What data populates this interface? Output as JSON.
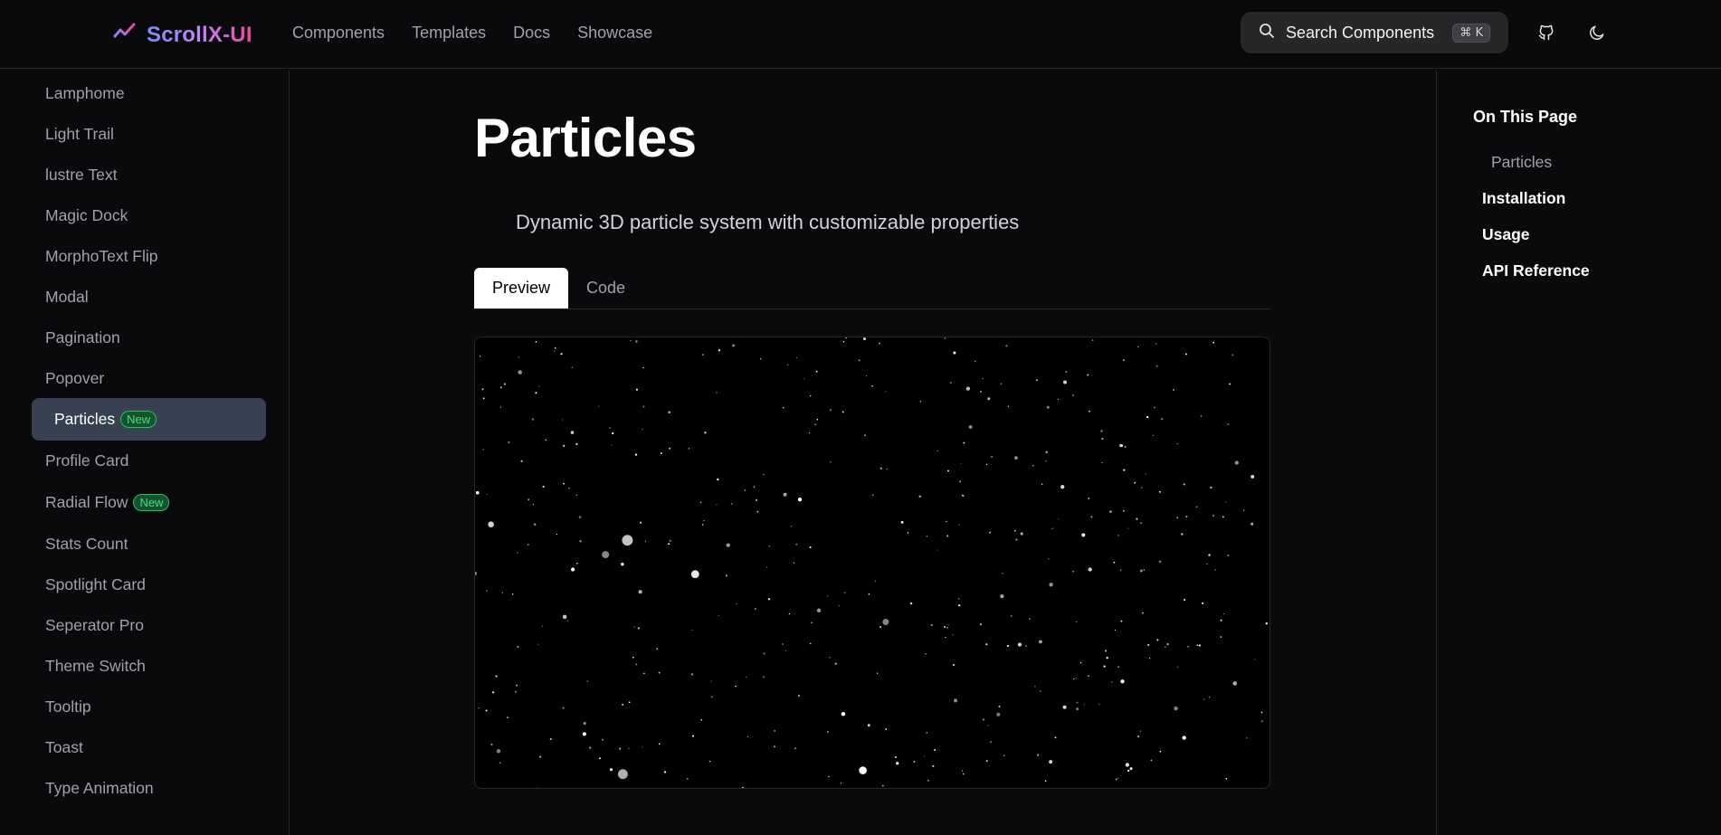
{
  "header": {
    "brand": "ScrollX-UI",
    "nav": [
      "Components",
      "Templates",
      "Docs",
      "Showcase"
    ],
    "search_label": "Search Components",
    "search_shortcut": "⌘ K"
  },
  "sidebar": {
    "items": [
      {
        "label": "Lamphome"
      },
      {
        "label": "Light Trail"
      },
      {
        "label": "lustre Text"
      },
      {
        "label": "Magic Dock"
      },
      {
        "label": "MorphoText Flip"
      },
      {
        "label": "Modal"
      },
      {
        "label": "Pagination"
      },
      {
        "label": "Popover"
      },
      {
        "label": "Particles",
        "badge": "New",
        "active": true
      },
      {
        "label": "Profile Card"
      },
      {
        "label": "Radial Flow",
        "badge": "New"
      },
      {
        "label": "Stats Count"
      },
      {
        "label": "Spotlight Card"
      },
      {
        "label": "Seperator Pro"
      },
      {
        "label": "Theme Switch"
      },
      {
        "label": "Tooltip"
      },
      {
        "label": "Toast"
      },
      {
        "label": "Type Animation"
      }
    ]
  },
  "main": {
    "title": "Particles",
    "description": "Dynamic 3D particle system with customizable properties",
    "tabs": [
      "Preview",
      "Code"
    ],
    "active_tab": "Preview"
  },
  "toc": {
    "title": "On This Page",
    "items": [
      "Particles",
      "Installation",
      "Usage",
      "API Reference"
    ]
  },
  "icons": {
    "brand": "trending-line-icon",
    "search": "search-icon",
    "github": "github-icon",
    "theme": "moon-icon"
  },
  "colors": {
    "background": "#0a0a0c",
    "brand_gradient_start": "#818cf8",
    "brand_gradient_end": "#ec4899",
    "active_item": "#374151",
    "badge_green": "#4ade80"
  }
}
